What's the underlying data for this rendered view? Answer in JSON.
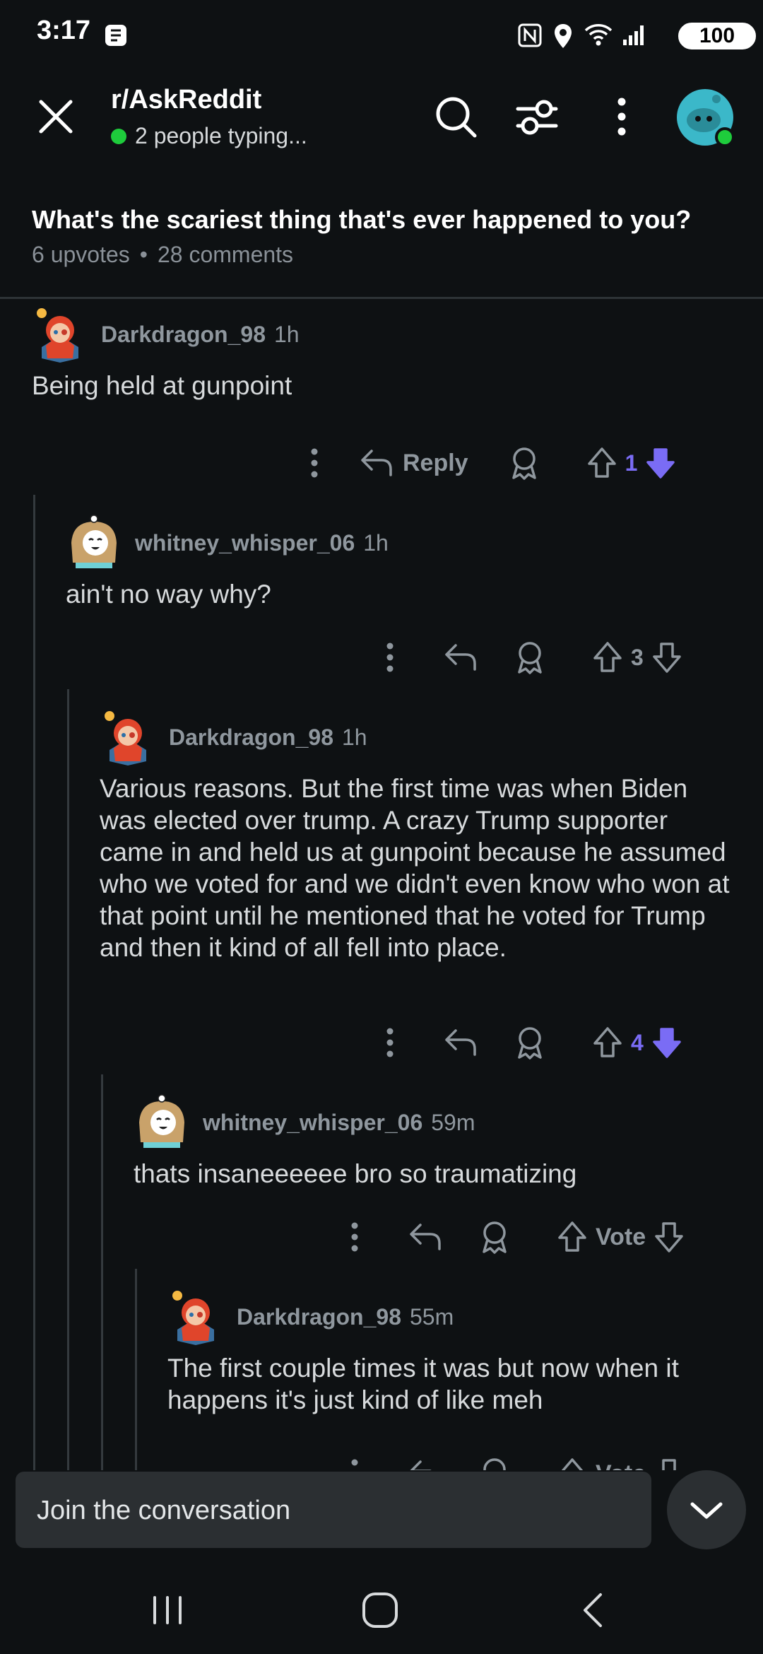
{
  "status_bar": {
    "time": "3:17",
    "battery": "100"
  },
  "header": {
    "subreddit": "r/AskReddit",
    "typing_status": "2 people typing..."
  },
  "post": {
    "title": "What's the scariest thing that's ever happened to you?",
    "upvotes": "6 upvotes",
    "separator": "•",
    "comments": "28 comments"
  },
  "comments": [
    {
      "username": "Darkdragon_98",
      "time": "1h",
      "body": "Being held at gunpoint",
      "reply_label": "Reply",
      "votes": "1"
    },
    {
      "username": "whitney_whisper_06",
      "time": "1h",
      "body": "ain't no way why?",
      "votes": "3"
    },
    {
      "username": "Darkdragon_98",
      "time": "1h",
      "body": "Various reasons. But the first time was when Biden was elected over trump. A crazy Trump supporter came in and held us at gunpoint because he assumed who we voted for and we didn't even know who won at that point until he mentioned that he voted for Trump and then it kind of all fell into place.",
      "votes": "4"
    },
    {
      "username": "whitney_whisper_06",
      "time": "59m",
      "body": "thats insaneeeeee bro so traumatizing",
      "votes": "Vote"
    },
    {
      "username": "Darkdragon_98",
      "time": "55m",
      "body": "The first couple times it was but now when it happens it's just kind of like meh",
      "votes": "Vote"
    }
  ],
  "composer": {
    "placeholder": "Join the conversation"
  },
  "colors": {
    "background": "#0e1113",
    "upvote_active": "#7a6cf5",
    "online_green": "#1ecc3c",
    "avatar_teal": "#3bb8c9"
  },
  "icons": [
    "close-icon",
    "search-icon",
    "filter-icon",
    "more-vertical-icon",
    "reply-icon",
    "award-icon",
    "upvote-icon",
    "downvote-icon",
    "chevron-down-icon",
    "recents-icon",
    "home-icon",
    "back-icon"
  ]
}
